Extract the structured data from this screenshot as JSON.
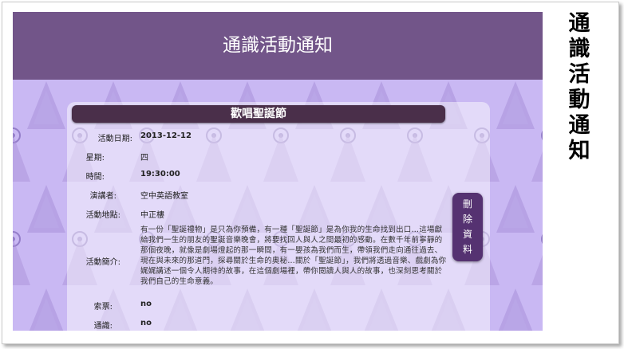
{
  "header": {
    "title": "通識活動通知"
  },
  "event": {
    "title": "歡唱聖誕節",
    "date_label": "活動日期:",
    "date_value": "2013-12-12",
    "weekday_label": "星期:",
    "weekday_value": "四",
    "time_label": "時間:",
    "time_value": "19:30:00",
    "speaker_label": "演講者:",
    "speaker_value": "空中英語教室",
    "location_label": "活動地點:",
    "location_value": "中正樓",
    "intro_label": "活動簡介:",
    "intro_value": "有一份「聖誕禮物」是只為你預備，有一種「聖誕節」是為你我的生命找到出口…這場獻給我們一生的朋友的聖誕音樂晚會，將要找回人與人之間最初的感動。在數千年前寧靜的那個夜晚，就像是劇場燈起的那一瞬間，有一嬰孩為我們而生，帶領我們走向通往過去、現在與未來的那道門，探尋關於生命的奧秘…關於「聖誕節」，我們將透過音樂、戲劇為你娓娓講述一個令人期待的故事，在這個劇場裡，帶你閱讀人與人的故事，也深刻思考關於我們自己的生命意義。",
    "ticket_label": "索票:",
    "ticket_value": "no",
    "general_label": "通識:",
    "general_value": "no"
  },
  "delete_button": {
    "chars": [
      "刪",
      "除",
      "資",
      "料"
    ]
  },
  "side_title": {
    "chars": [
      "通",
      "識",
      "活",
      "動",
      "通",
      "知"
    ]
  },
  "colors": {
    "header": "#725589",
    "background": "#c9b8f3",
    "event_bar": "#4a2f4a",
    "delete_button": "#553271"
  }
}
